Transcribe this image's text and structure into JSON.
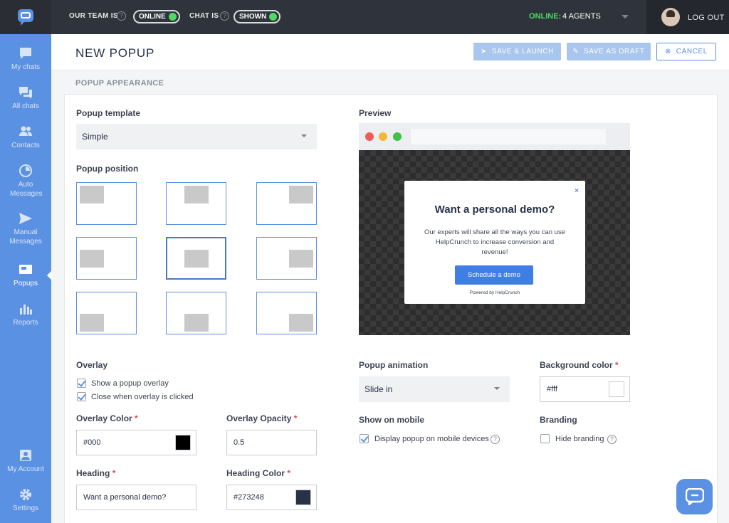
{
  "topbar": {
    "team_label": "OUR TEAM IS",
    "team_status": "ONLINE",
    "chat_label": "CHAT IS",
    "chat_status": "SHOWN",
    "online_label": "ONLINE:",
    "agents": "4 AGENTS",
    "logout": "LOG OUT"
  },
  "sidebar": {
    "items": [
      {
        "label": "My chats",
        "icon": "chat-bubble-icon"
      },
      {
        "label": "All chats",
        "icon": "chats-icon"
      },
      {
        "label": "Contacts",
        "icon": "contacts-icon"
      },
      {
        "label": "Auto Messages",
        "icon": "clock-icon"
      },
      {
        "label": "Manual Messages",
        "icon": "send-icon"
      },
      {
        "label": "Popups",
        "icon": "popup-icon"
      },
      {
        "label": "Reports",
        "icon": "bar-chart-icon"
      },
      {
        "label": "My Account",
        "icon": "account-icon"
      },
      {
        "label": "Settings",
        "icon": "gear-icon"
      }
    ],
    "active": "Popups"
  },
  "header": {
    "title": "NEW POPUP",
    "save_launch": "SAVE & LAUNCH",
    "save_draft": "SAVE AS DRAFT",
    "cancel": "CANCEL"
  },
  "section": {
    "title": "POPUP APPEARANCE"
  },
  "form": {
    "template_label": "Popup template",
    "template_value": "Simple",
    "position_label": "Popup position",
    "position_selected": "middle-center",
    "overlay_label": "Overlay",
    "show_overlay": "Show a popup overlay",
    "close_overlay": "Close when overlay is clicked",
    "overlay_color_label": "Overlay Color",
    "overlay_color_value": "#000",
    "overlay_opacity_label": "Overlay Opacity",
    "overlay_opacity_value": "0.5",
    "heading_label": "Heading",
    "heading_value": "Want a personal demo?",
    "heading_color_label": "Heading Color",
    "heading_color_value": "#273248",
    "preview_label": "Preview",
    "animation_label": "Popup animation",
    "animation_value": "Slide in",
    "bg_color_label": "Background color",
    "bg_color_value": "#fff",
    "mobile_label": "Show on mobile",
    "mobile_option": "Display popup on mobile devices",
    "branding_label": "Branding",
    "branding_option": "Hide branding",
    "required_mark": "*"
  },
  "preview": {
    "heading": "Want a personal demo?",
    "text": "Our experts will share all the ways you can use HelpCrunch to increase conversion and revenue!",
    "button": "Schedule a demo",
    "powered": "Powered by HelpCrunch",
    "close": "×"
  },
  "colors": {
    "accent": "#5b91e2",
    "online": "#4cd964",
    "topbar": "#2f333b",
    "heading_color": "#273248"
  }
}
